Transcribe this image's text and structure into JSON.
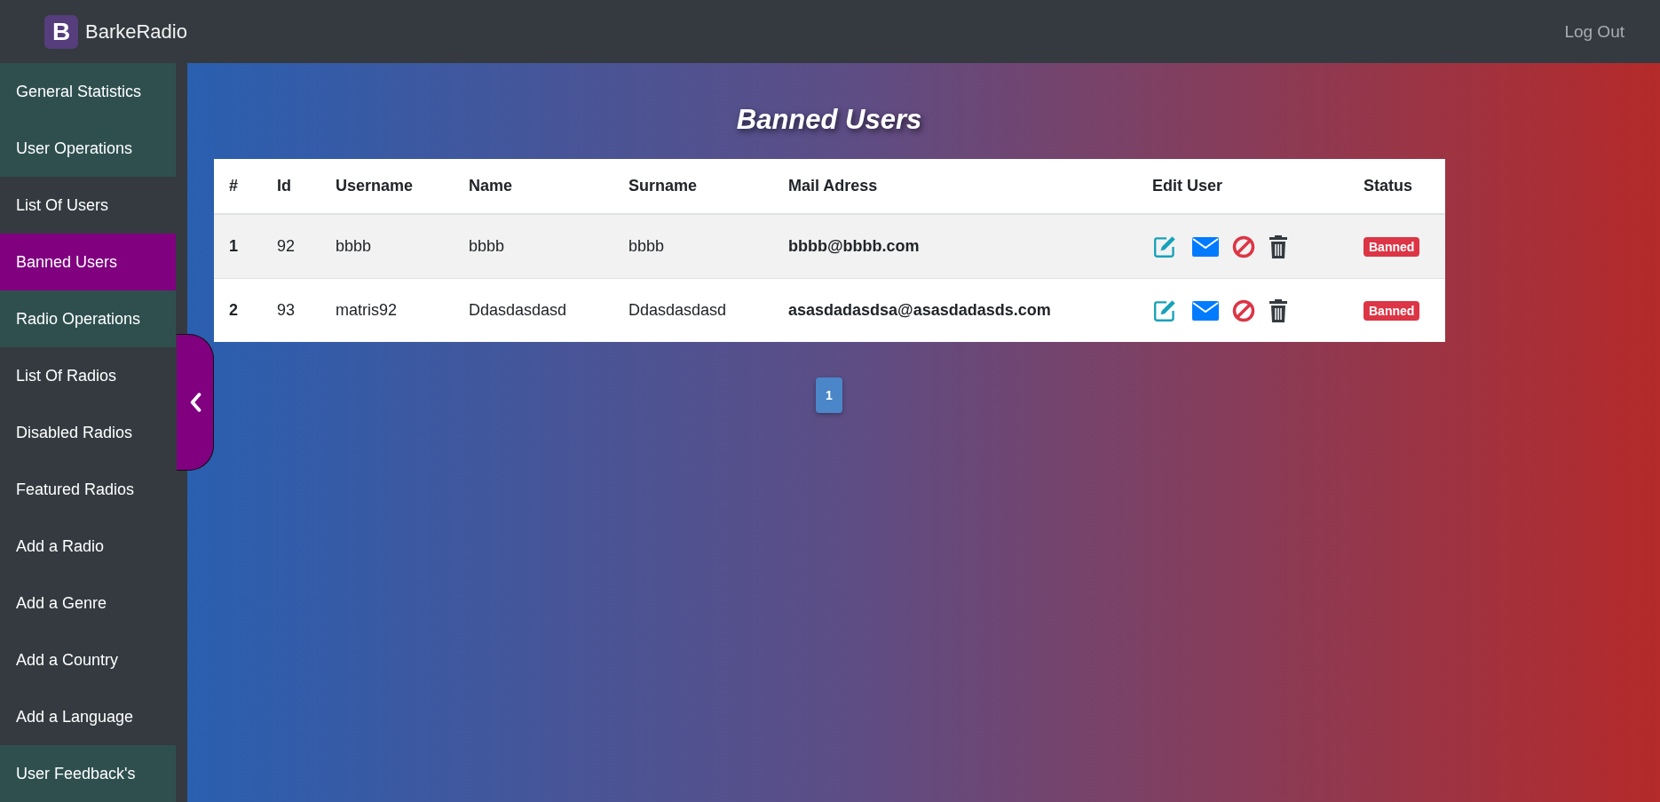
{
  "brand": {
    "logo_letter": "B",
    "name": "BarkeRadio"
  },
  "navbar": {
    "logout": "Log Out"
  },
  "sidebar": {
    "items": [
      {
        "label": "General Statistics",
        "kind": "header",
        "selected": false
      },
      {
        "label": "User Operations",
        "kind": "header",
        "selected": false
      },
      {
        "label": "List Of Users",
        "kind": "link",
        "selected": false
      },
      {
        "label": "Banned Users",
        "kind": "link",
        "selected": true
      },
      {
        "label": "Radio Operations",
        "kind": "header",
        "selected": false
      },
      {
        "label": "List Of Radios",
        "kind": "link",
        "selected": false
      },
      {
        "label": "Disabled Radios",
        "kind": "link",
        "selected": false
      },
      {
        "label": "Featured Radios",
        "kind": "link",
        "selected": false
      },
      {
        "label": "Add a Radio",
        "kind": "link",
        "selected": false
      },
      {
        "label": "Add a Genre",
        "kind": "link",
        "selected": false
      },
      {
        "label": "Add a Country",
        "kind": "link",
        "selected": false
      },
      {
        "label": "Add a Language",
        "kind": "link",
        "selected": false
      },
      {
        "label": "User Feedback's",
        "kind": "header",
        "selected": false
      }
    ]
  },
  "page_title": "Banned Users",
  "table": {
    "columns": [
      "#",
      "Id",
      "Username",
      "Name",
      "Surname",
      "Mail Adress",
      "Edit User",
      "Status"
    ],
    "rows": [
      {
        "index": "1",
        "id": "92",
        "username": "bbbb",
        "name": "bbbb",
        "surname": "bbbb",
        "mail": "bbbb@bbbb.com",
        "status": "Banned"
      },
      {
        "index": "2",
        "id": "93",
        "username": "matris92",
        "name": "Ddasdasdasd",
        "surname": "Ddasdasdasd",
        "mail": "asasdadasdsa@asasdadasds.com",
        "status": "Banned"
      }
    ]
  },
  "pagination": [
    {
      "label": "1",
      "selected": true
    }
  ]
}
